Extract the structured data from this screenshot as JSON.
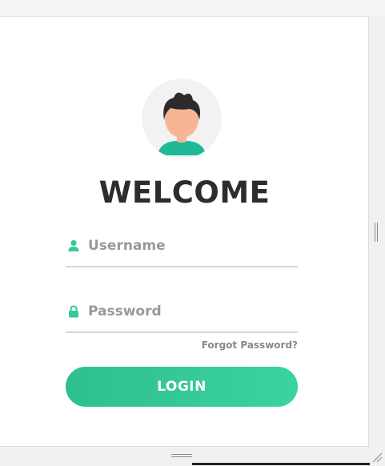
{
  "login": {
    "title": "WELCOME",
    "username_placeholder": "Username",
    "username_value": "",
    "password_placeholder": "Password",
    "password_value": "",
    "forgot_label": "Forgot Password?",
    "login_label": "LOGIN"
  },
  "icons": {
    "avatar": "user-avatar-icon",
    "username": "user-icon",
    "password": "lock-icon"
  },
  "colors": {
    "accent": "#34c996",
    "title": "#2d2d2d",
    "placeholder": "#999999",
    "button_gradient_start": "#2fbf8e",
    "button_gradient_end": "#3ad39e"
  }
}
